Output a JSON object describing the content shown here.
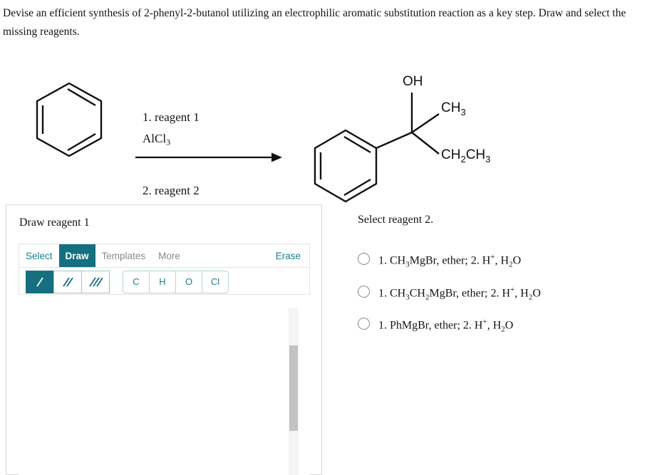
{
  "prompt": "Devise an efficient synthesis of 2-phenyl-2-butanol utilizing an electrophilic aromatic substitution reaction as a key step. Draw and select the missing reagents.",
  "scheme": {
    "reactant_name": "benzene",
    "product_name": "2-phenyl-2-butanol",
    "conditions": {
      "step1_line1": "1. reagent 1",
      "step1_line2_formula": "AlCl",
      "step1_line2_sub": "3",
      "step2": "2. reagent 2"
    },
    "product_labels": {
      "hydroxyl": "OH",
      "methyl": "CH",
      "methyl_sub": "3",
      "ethyl_a": "CH",
      "ethyl_a_sub": "2",
      "ethyl_b": "CH",
      "ethyl_b_sub": "3"
    }
  },
  "draw_panel": {
    "title": "Draw reagent 1",
    "tabs": [
      {
        "label": "Select",
        "state": "inactive"
      },
      {
        "label": "Draw",
        "state": "active"
      },
      {
        "label": "Templates",
        "state": "muted"
      },
      {
        "label": "More",
        "state": "muted"
      }
    ],
    "erase_label": "Erase",
    "bond_tools": [
      {
        "name": "single-bond",
        "selected": true
      },
      {
        "name": "double-bond",
        "selected": false
      },
      {
        "name": "triple-bond",
        "selected": false
      }
    ],
    "element_buttons": [
      "C",
      "H",
      "O",
      "Cl"
    ],
    "accent_color": "#14707f",
    "accent_text_color": "#1a7f8e"
  },
  "answer_panel": {
    "title": "Select reagent 2.",
    "options": [
      {
        "selected": false,
        "parts": [
          {
            "t": "1. CH"
          },
          {
            "t": "3",
            "k": "sub"
          },
          {
            "t": "MgBr, ether; 2. H"
          },
          {
            "t": "+",
            "k": "sup"
          },
          {
            "t": ", H"
          },
          {
            "t": "2",
            "k": "sub"
          },
          {
            "t": "O"
          }
        ]
      },
      {
        "selected": false,
        "parts": [
          {
            "t": "1. CH"
          },
          {
            "t": "3",
            "k": "sub"
          },
          {
            "t": "CH"
          },
          {
            "t": "2",
            "k": "sub"
          },
          {
            "t": "MgBr, ether; 2. H"
          },
          {
            "t": "+",
            "k": "sup"
          },
          {
            "t": ", H"
          },
          {
            "t": "2",
            "k": "sub"
          },
          {
            "t": "O"
          }
        ]
      },
      {
        "selected": false,
        "parts": [
          {
            "t": "1. PhMgBr, ether; 2. H"
          },
          {
            "t": "+",
            "k": "sup"
          },
          {
            "t": ", H"
          },
          {
            "t": "2",
            "k": "sub"
          },
          {
            "t": "O"
          }
        ]
      }
    ]
  }
}
